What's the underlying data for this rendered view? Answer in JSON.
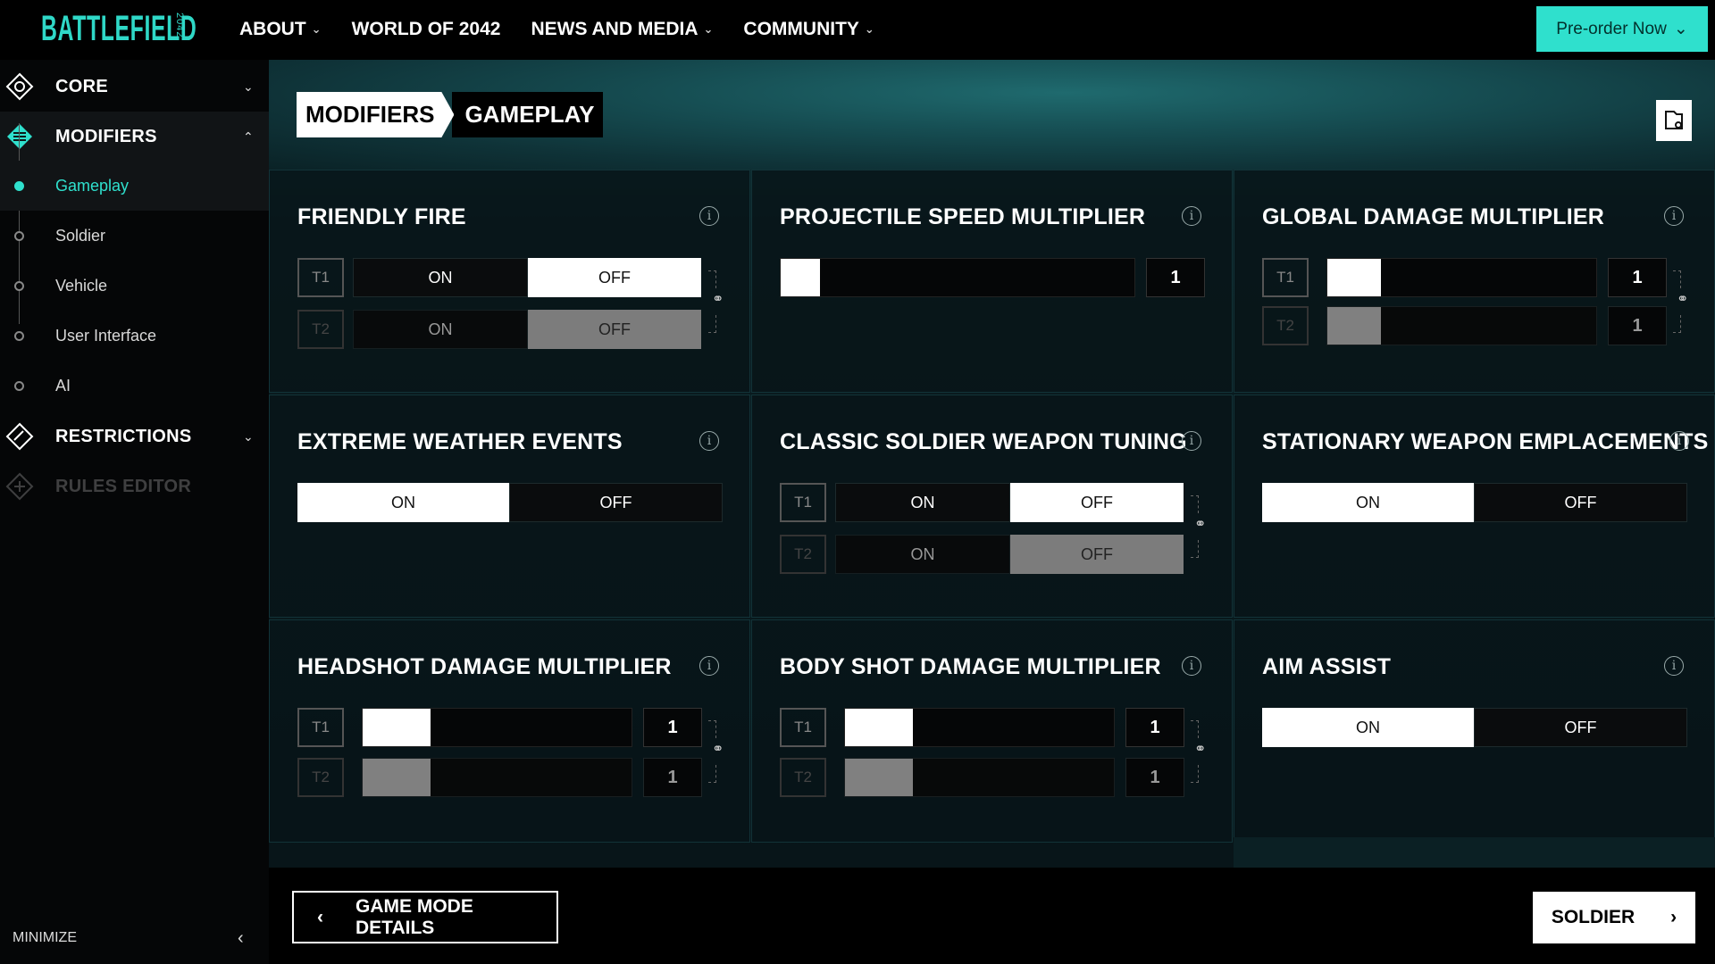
{
  "header": {
    "logo": "BATTLEFIELD",
    "logo_sub": "2042",
    "nav": [
      "ABOUT",
      "WORLD OF 2042",
      "NEWS AND MEDIA",
      "COMMUNITY"
    ],
    "preorder": "Pre-order Now"
  },
  "sidebar": {
    "sections": [
      "CORE",
      "MODIFIERS",
      "RESTRICTIONS",
      "RULES EDITOR"
    ],
    "sub_items": [
      "Gameplay",
      "Soldier",
      "Vehicle",
      "User Interface",
      "AI"
    ],
    "active_sub": "Gameplay",
    "minimize": "MINIMIZE"
  },
  "breadcrumb": {
    "a": "MODIFIERS",
    "b": "GAMEPLAY"
  },
  "toggle": {
    "on": "ON",
    "off": "OFF",
    "t1": "T1",
    "t2": "T2"
  },
  "cards": {
    "friendly_fire": {
      "title": "FRIENDLY FIRE",
      "t1": "OFF",
      "t2": "OFF"
    },
    "projectile_speed": {
      "title": "PROJECTILE SPEED MULTIPLIER",
      "value": "1"
    },
    "global_damage": {
      "title": "GLOBAL DAMAGE MULTIPLIER",
      "t1": "1",
      "t2": "1"
    },
    "extreme_weather": {
      "title": "EXTREME WEATHER EVENTS",
      "value": "ON"
    },
    "classic_tuning": {
      "title": "CLASSIC SOLDIER WEAPON TUNING",
      "t1": "OFF",
      "t2": "OFF"
    },
    "stationary": {
      "title": "STATIONARY WEAPON EMPLACEMENTS",
      "value": "ON"
    },
    "headshot": {
      "title": "HEADSHOT DAMAGE MULTIPLIER",
      "t1": "1",
      "t2": "1"
    },
    "bodyshot": {
      "title": "BODY SHOT DAMAGE MULTIPLIER",
      "t1": "1",
      "t2": "1"
    },
    "aim_assist": {
      "title": "AIM ASSIST",
      "value": "ON"
    }
  },
  "footer": {
    "back": "GAME MODE DETAILS",
    "next": "SOLDIER"
  },
  "colors": {
    "accent": "#2fe0cd",
    "background": "#060708"
  }
}
